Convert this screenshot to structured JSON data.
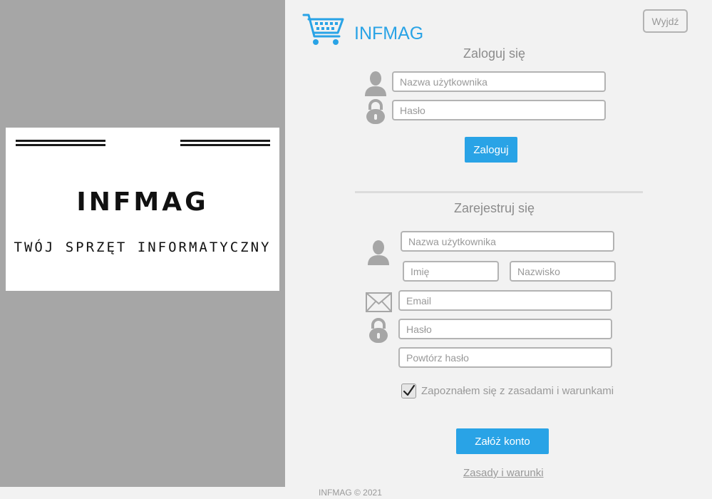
{
  "banner": {
    "title": "INFMAG",
    "subtitle": "TWÓJ SPRZĘT INFORMATYCZNY"
  },
  "header": {
    "logo_icon": "shopping-cart-icon",
    "brand": "INFMAG",
    "exit_label": "Wyjdź",
    "accent_color": "#29a3e6"
  },
  "login": {
    "heading": "Zaloguj się",
    "username_placeholder": "Nazwa użytkownika",
    "password_placeholder": "Hasło",
    "submit_label": "Zaloguj"
  },
  "register": {
    "heading": "Zarejestruj się",
    "username_placeholder": "Nazwa użytkownika",
    "first_name_placeholder": "Imię",
    "last_name_placeholder": "Nazwisko",
    "email_placeholder": "Email",
    "password_placeholder": "Hasło",
    "repeat_password_placeholder": "Powtórz hasło",
    "terms_checkbox_label": "Zapoznałem się z zasadami i warunkami",
    "terms_checked": true,
    "submit_label": "Załóż konto",
    "terms_link": "Zasady i warunki"
  },
  "footer": {
    "text": "INFMAG © 2021"
  }
}
